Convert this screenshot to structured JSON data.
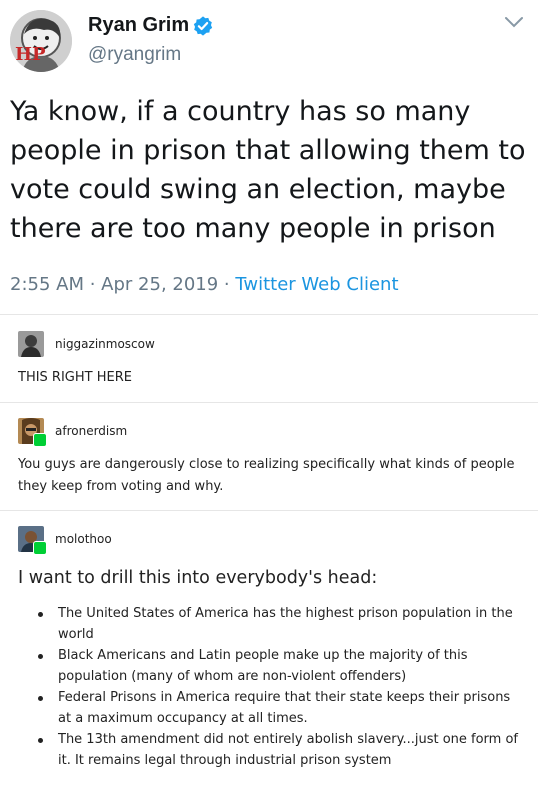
{
  "tweet": {
    "author_name": "Ryan Grim",
    "handle": "@ryangrim",
    "avatar_text": "HP",
    "text": "Ya know, if a country has so many people in prison that allowing them to vote could swing an election, maybe there are too many people in prison",
    "time": "2:55 AM",
    "sep1": " · ",
    "date": "Apr 25, 2019",
    "sep2": " · ",
    "client": "Twitter Web Client"
  },
  "posts": [
    {
      "username": "niggazinmoscow",
      "text": "THIS RIGHT HERE"
    },
    {
      "username": "afronerdism",
      "text": "You guys are dangerously close to realizing specifically what kinds of people they keep from voting and why."
    },
    {
      "username": "molothoo",
      "headline": "I want to drill this into everybody's head:",
      "bullets": [
        "The United States of America has the highest prison population in the world",
        "Black Americans and Latin people make up the majority of this population (many of whom are non-violent offenders)",
        "Federal Prisons in America require that their state keeps their prisons at a maximum occupancy at all times.",
        "The 13th amendment did not entirely abolish slavery...just one form of it. It remains legal through industrial prison system"
      ]
    }
  ],
  "colors": {
    "verified": "#1da1f2",
    "link": "#1b95e0",
    "muted": "#657786",
    "reblog_badge": "#00cf35"
  }
}
